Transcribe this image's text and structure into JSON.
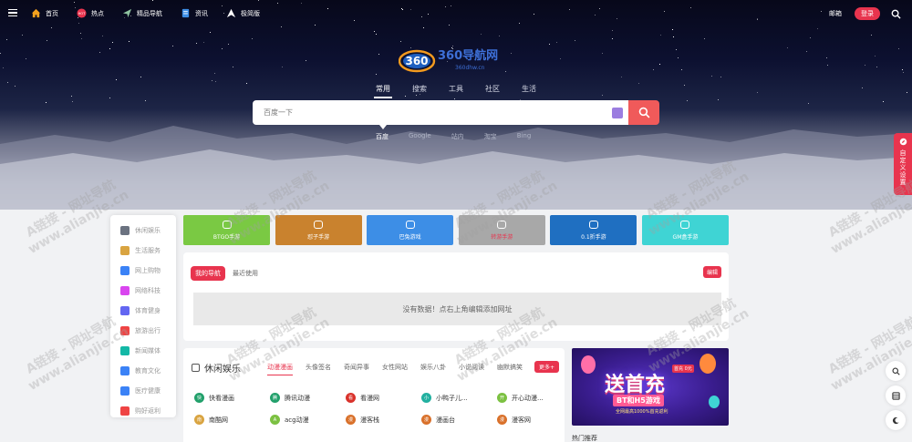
{
  "topbar": {
    "nav": [
      {
        "label": "首页",
        "icon": "home-icon"
      },
      {
        "label": "热点",
        "icon": "hot-icon"
      },
      {
        "label": "精品导航",
        "icon": "send-icon"
      },
      {
        "label": "资讯",
        "icon": "document-icon"
      },
      {
        "label": "极简版",
        "icon": "triangle-icon"
      }
    ],
    "mail_label": "邮箱",
    "login_label": "登录"
  },
  "logo": {
    "text": "360导航网",
    "sub": "360dhw.cn",
    "badge": "360"
  },
  "search": {
    "tabs": [
      "常用",
      "搜索",
      "工具",
      "社区",
      "生活"
    ],
    "active_tab": "常用",
    "placeholder": "百度一下",
    "engines": [
      "百度",
      "Google",
      "站内",
      "淘宝",
      "Bing"
    ],
    "active_engine": "百度"
  },
  "categories": [
    {
      "label": "休闲娱乐",
      "color": "#6b7280"
    },
    {
      "label": "生活服务",
      "color": "#d9a441"
    },
    {
      "label": "网上购物",
      "color": "#3b82f6"
    },
    {
      "label": "网络科技",
      "color": "#d946ef"
    },
    {
      "label": "体育健身",
      "color": "#6366f1"
    },
    {
      "label": "旅游出行",
      "color": "#ef4444"
    },
    {
      "label": "新闻媒体",
      "color": "#14b8a6"
    },
    {
      "label": "教育文化",
      "color": "#3b82f6"
    },
    {
      "label": "医疗健康",
      "color": "#3b82f6"
    },
    {
      "label": "购好返利",
      "color": "#ef4444"
    }
  ],
  "apps": [
    {
      "label": "BTGO手游",
      "color": "#7ac943"
    },
    {
      "label": "怼子手游",
      "color": "#c9822e"
    },
    {
      "label": "巴兔游戏",
      "color": "#3d8ee6"
    },
    {
      "label": "转游手游",
      "color": "#a8a8a8"
    },
    {
      "label": "0.1折手游",
      "color": "#1f6fc1"
    },
    {
      "label": "GM盒手游",
      "color": "#3fd4d4"
    }
  ],
  "mynav": {
    "tab_mine": "我的导航",
    "tab_recent": "最近使用",
    "edit_label": "编辑",
    "empty_text": "没有数据！点右上角编辑添加网址"
  },
  "leisure": {
    "title": "休闲娱乐",
    "tabs": [
      "动漫漫画",
      "头像签名",
      "奇闻异事",
      "女性网站",
      "娱乐八卦",
      "小说阅读",
      "幽默搞笑"
    ],
    "active_tab": "动漫漫画",
    "more_label": "更多+",
    "sites": [
      {
        "label": "快看漫画",
        "icon": "快",
        "color": "#22a06b"
      },
      {
        "label": "腾讯动漫",
        "icon": "腾",
        "color": "#22a06b"
      },
      {
        "label": "看漫网",
        "icon": "看",
        "color": "#d9322b"
      },
      {
        "label": "小鸭子儿...",
        "icon": "小",
        "color": "#22b0a0"
      },
      {
        "label": "开心动漫...",
        "icon": "开",
        "color": "#7cc142"
      },
      {
        "label": "南酷网",
        "icon": "南",
        "color": "#d9a441"
      },
      {
        "label": "acg动漫",
        "icon": "A",
        "color": "#7cc142"
      },
      {
        "label": "漫客栈",
        "icon": "漫",
        "color": "#d9712b"
      },
      {
        "label": "漫画台",
        "icon": "漫",
        "color": "#d9712b"
      },
      {
        "label": "漫客网",
        "icon": "漫",
        "color": "#d9712b"
      }
    ]
  },
  "banner": {
    "headline": "送首充",
    "tag": "首充 0元",
    "subline": "BT和H5游戏",
    "tiny": "全网最高1000%首充返利"
  },
  "below_banner_label": "热门推荐",
  "custom_panel": {
    "label": "自定义设置"
  },
  "watermark": {
    "line1": "A链接 - 网址导航",
    "line2": "www.alianjie.cn"
  }
}
